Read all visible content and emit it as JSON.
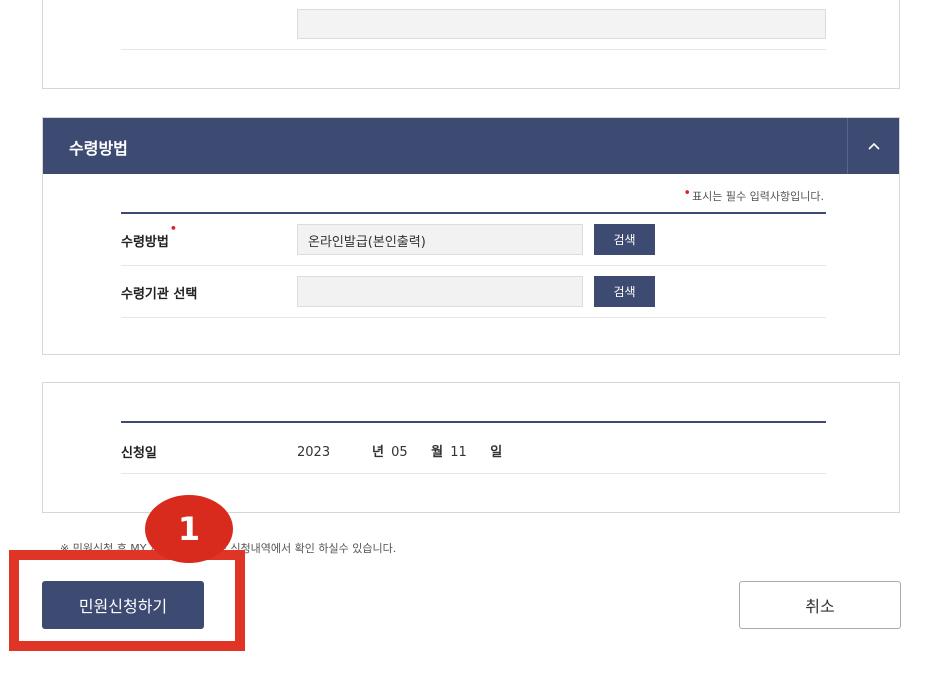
{
  "receive_section": {
    "title": "수령방법",
    "required_note": "표시는 필수 입력사항입니다.",
    "rows": [
      {
        "label": "수령방법",
        "value": "온라인발급(본인출력)",
        "button": "검색"
      },
      {
        "label": "수령기관 선택",
        "value": "",
        "button": "검색"
      }
    ]
  },
  "date_section": {
    "label": "신청일",
    "year": "2023",
    "year_unit": "년",
    "month": "05",
    "month_unit": "월",
    "day": "11",
    "day_unit": "일"
  },
  "notice": "※ 민원신청 후 MY 서비스 > 서비스 신청내역에서 확인 하실수 있습니다.",
  "buttons": {
    "submit": "민원신청하기",
    "cancel": "취소"
  },
  "annotation": {
    "step_number": "1",
    "color": "#e03427"
  },
  "colors": {
    "header": "#3d4a72",
    "required_dot": "#d9242a"
  }
}
